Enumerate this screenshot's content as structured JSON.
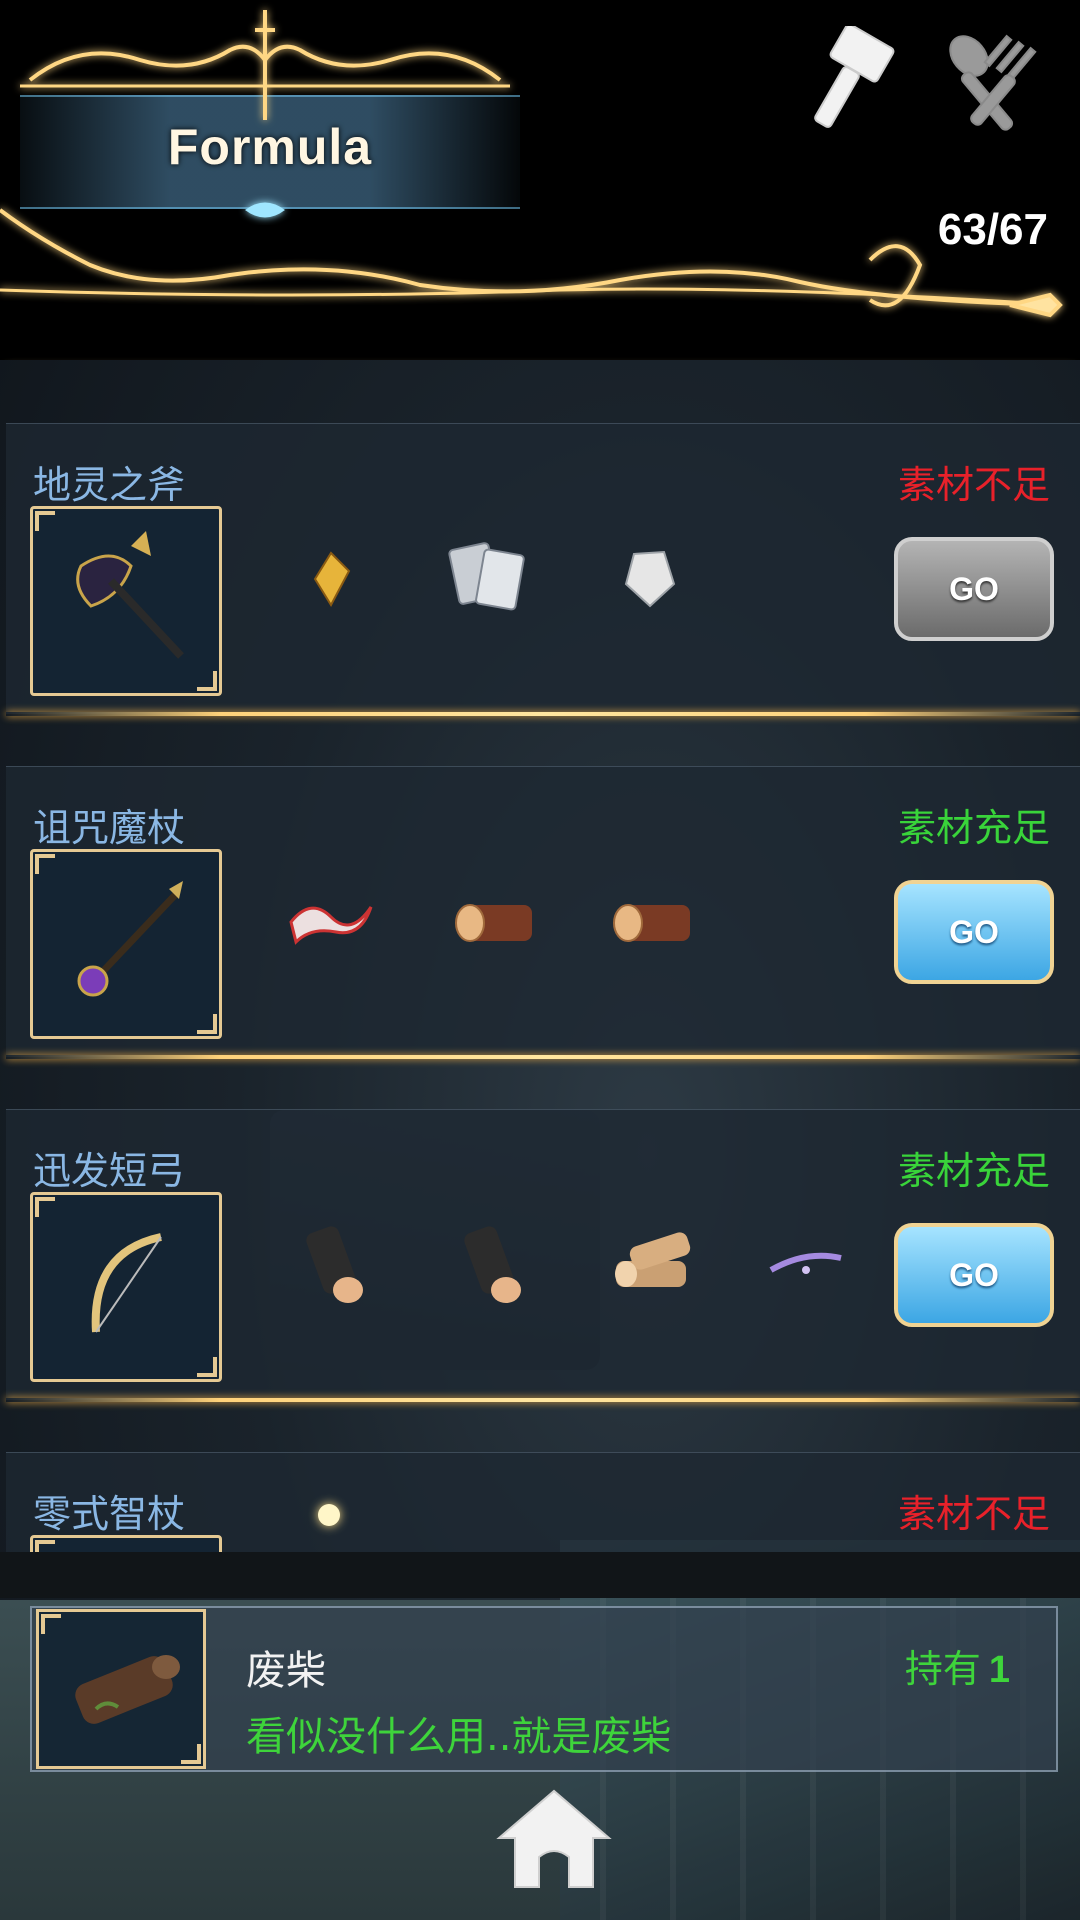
{
  "header": {
    "title": "Formula",
    "count": "63/67"
  },
  "tabs": [
    {
      "icon": "hammer-icon"
    },
    {
      "icon": "spoon-fork-icon"
    }
  ],
  "recipes": [
    {
      "name": "地灵之斧",
      "status": "素材不足",
      "status_color": "#e8212a",
      "item_icon": "dark-axe-icon",
      "materials": [
        "gold-shard-icon",
        "silver-plates-icon",
        "crystal-icon"
      ],
      "go_label": "GO",
      "go_enabled": false
    },
    {
      "name": "诅咒魔杖",
      "status": "素材充足",
      "status_color": "#39d43a",
      "item_icon": "cursed-staff-icon",
      "materials": [
        "ribbon-icon",
        "log-icon",
        "log-icon"
      ],
      "go_label": "GO",
      "go_enabled": true
    },
    {
      "name": "迅发短弓",
      "status": "素材充足",
      "status_color": "#39d43a",
      "item_icon": "short-bow-icon",
      "materials": [
        "dark-log-icon",
        "dark-log-icon",
        "wood-pile-icon",
        "bowstring-icon"
      ],
      "go_label": "GO",
      "go_enabled": true
    },
    {
      "name": "零式智杖",
      "status": "素材不足",
      "status_color": "#e8212a"
    }
  ],
  "info": {
    "item_icon": "firewood-icon",
    "name": "废柴",
    "owned_label": "持有",
    "owned_count": "1",
    "description": "看似没什么用..就是废柴"
  },
  "nav": {
    "home_icon": "home-icon"
  }
}
